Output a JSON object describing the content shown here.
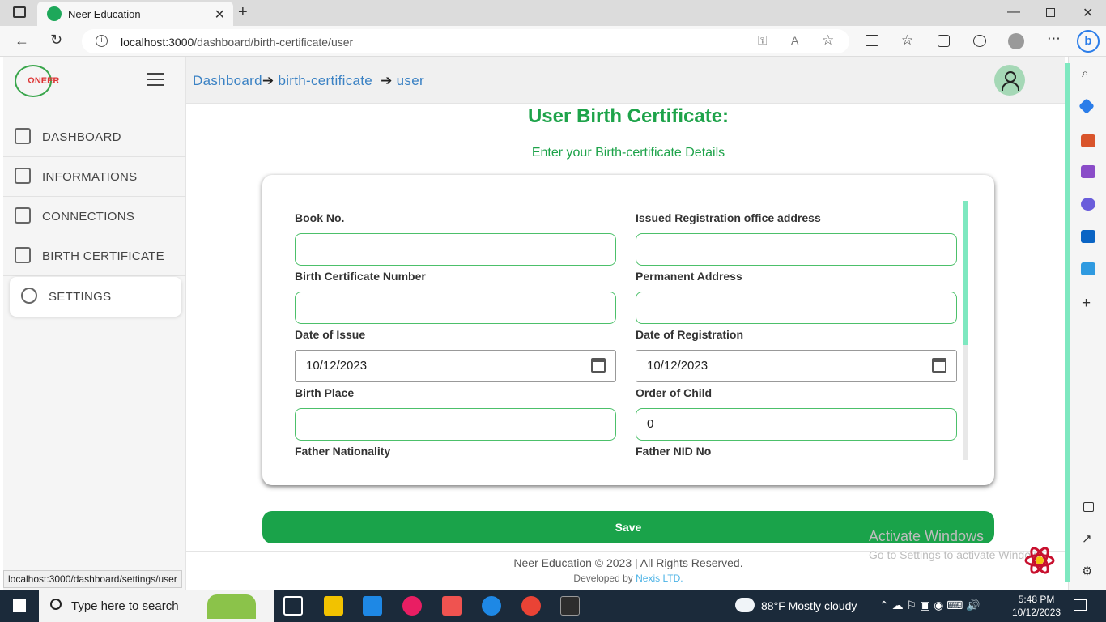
{
  "browser": {
    "tab_title": "Neer Education",
    "url_host": "localhost:3000",
    "url_path": "/dashboard/birth-certificate/user",
    "status_url": "localhost:3000/dashboard/settings/user"
  },
  "sidebar": {
    "items": [
      {
        "label": "DASHBOARD"
      },
      {
        "label": "INFORMATIONS"
      },
      {
        "label": "CONNECTIONS"
      },
      {
        "label": "BIRTH CERTIFICATE"
      },
      {
        "label": "SETTINGS"
      }
    ]
  },
  "breadcrumb": {
    "part1": "Dashboard",
    "part2": "birth-certificate",
    "part3": "user"
  },
  "page": {
    "title": "User Birth Certificate:",
    "subtitle": "Enter your Birth-certificate Details"
  },
  "form": {
    "book_no_label": "Book No.",
    "office_address_label": "Issued Registration office address",
    "cert_number_label": "Birth Certificate Number",
    "permanent_address_label": "Permanent Address",
    "date_issue_label": "Date of Issue",
    "date_issue_value": "10/12/2023",
    "date_reg_label": "Date of Registration",
    "date_reg_value": "10/12/2023",
    "birth_place_label": "Birth Place",
    "order_child_label": "Order of Child",
    "order_child_value": "0",
    "father_nationality_label": "Father Nationality",
    "father_nid_label": "Father NID No",
    "save_label": "Save"
  },
  "footer": {
    "copyright": "Neer Education © 2023 | All Rights Reserved.",
    "developed_by": "Developed by",
    "company": "Nexis LTD."
  },
  "watermark": {
    "line1": "Activate Windows",
    "line2": "Go to Settings to activate Windows."
  },
  "taskbar": {
    "search_placeholder": "Type here to search",
    "weather": "88°F  Mostly cloudy",
    "time": "5:48 PM",
    "date": "10/12/2023"
  },
  "colors": {
    "accent_green": "#1ea34a",
    "link_blue": "#3b82c4"
  }
}
